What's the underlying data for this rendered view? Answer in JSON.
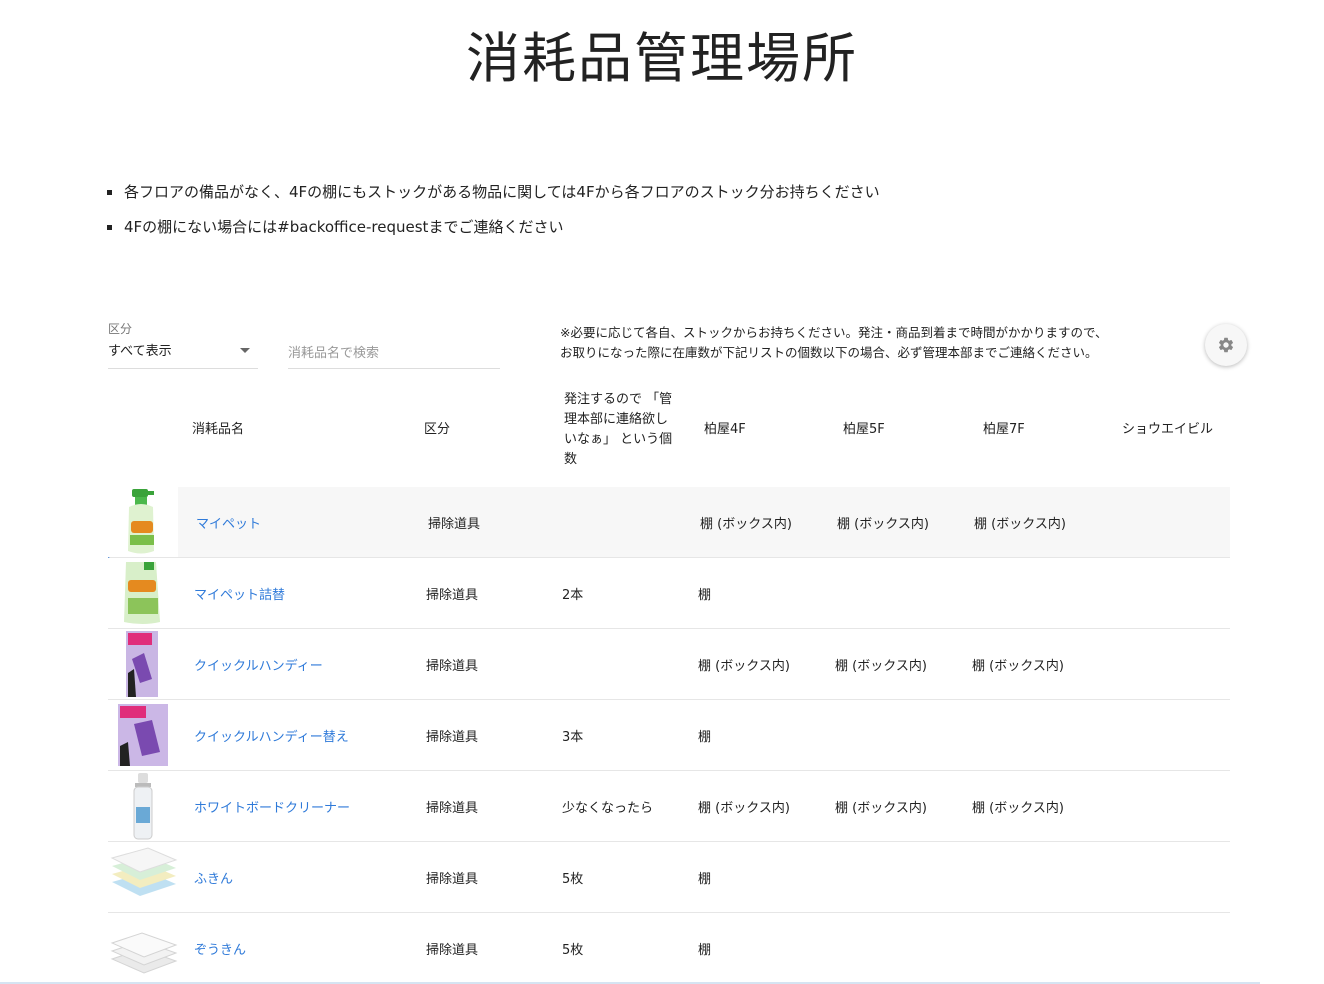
{
  "page": {
    "title": "消耗品管理場所"
  },
  "notes": [
    "各フロアの備品がなく、4Fの棚にもストックがある物品に関しては4Fから各フロアのストック分お持ちください",
    "4Fの棚にない場合には#backoffice-requestまでご連絡ください"
  ],
  "filter": {
    "label": "区分",
    "value": "すべて表示"
  },
  "search": {
    "placeholder": "消耗品名で検索"
  },
  "notice": {
    "line1": "※必要に応じて各自、ストックからお持ちください。発注・商品到着まで時間がかかりますので、",
    "line2": "お取りになった際に在庫数が下記リストの個数以下の場合、必ず管理本部までご連絡ください。"
  },
  "table": {
    "headers": {
      "name": "消耗品名",
      "category": "区分",
      "threshold_lines": [
        "発注するので 「管",
        "理本部に連絡欲し",
        "いなぁ」 という個",
        "数"
      ],
      "kashiwaya4f": "柏屋4F",
      "kashiwaya5f": "柏屋5F",
      "kashiwaya7f": "柏屋7F",
      "shoei": "ショウエイビル"
    },
    "rows": [
      {
        "name": "マイペット",
        "category": "掃除道具",
        "threshold": "",
        "f4": "棚 (ボックス内)",
        "f5": "棚 (ボックス内)",
        "f7": "棚 (ボックス内)",
        "shoei": ""
      },
      {
        "name": "マイペット詰替",
        "category": "掃除道具",
        "threshold": "2本",
        "f4": "棚",
        "f5": "",
        "f7": "",
        "shoei": ""
      },
      {
        "name": "クイックルハンディー",
        "category": "掃除道具",
        "threshold": "",
        "f4": "棚 (ボックス内)",
        "f5": "棚 (ボックス内)",
        "f7": "棚 (ボックス内)",
        "shoei": ""
      },
      {
        "name": "クイックルハンディー替え",
        "category": "掃除道具",
        "threshold": "3本",
        "f4": "棚",
        "f5": "",
        "f7": "",
        "shoei": ""
      },
      {
        "name": "ホワイトボードクリーナー",
        "category": "掃除道具",
        "threshold": "少なくなったら",
        "f4": "棚 (ボックス内)",
        "f5": "棚 (ボックス内)",
        "f7": "棚 (ボックス内)",
        "shoei": ""
      },
      {
        "name": "ふきん",
        "category": "掃除道具",
        "threshold": "5枚",
        "f4": "棚",
        "f5": "",
        "f7": "",
        "shoei": ""
      },
      {
        "name": "ぞうきん",
        "category": "掃除道具",
        "threshold": "5枚",
        "f4": "棚",
        "f5": "",
        "f7": "",
        "shoei": ""
      }
    ]
  }
}
